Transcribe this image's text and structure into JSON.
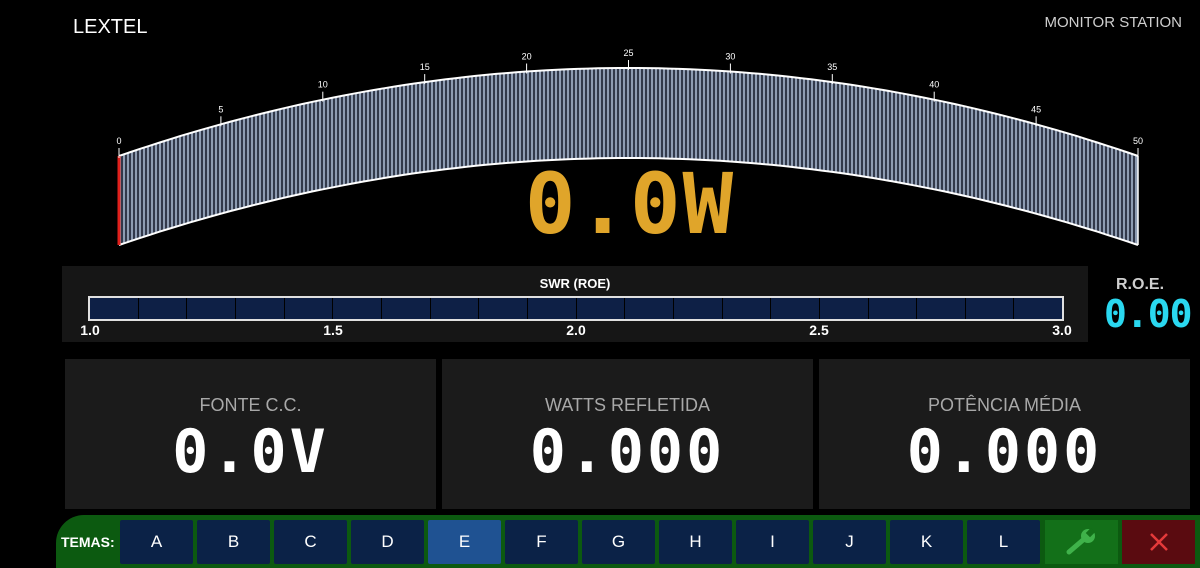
{
  "header": {
    "brand": "LEXTEL",
    "station": "MONITOR STATION"
  },
  "power_meter": {
    "scale_labels": [
      "0",
      "5",
      "10",
      "15",
      "20",
      "25",
      "30",
      "35",
      "40",
      "45",
      "50"
    ],
    "value": 0,
    "readout": "0.0W",
    "colors": {
      "needle": "#e0201c",
      "readout": "#e0a52a",
      "fill": "#8e9cb2"
    }
  },
  "swr": {
    "title": "SWR (ROE)",
    "ticks": [
      "1.0",
      "1.5",
      "2.0",
      "2.5",
      "3.0"
    ],
    "level": 0
  },
  "roe": {
    "label": "R.O.E.",
    "value": "0.00",
    "color": "#2ad8f0"
  },
  "cards": [
    {
      "label": "FONTE C.C.",
      "value": "0.0V"
    },
    {
      "label": "WATTS REFLETIDA",
      "value": "0.000"
    },
    {
      "label": "POTÊNCIA MÉDIA",
      "value": "0.000"
    }
  ],
  "themes": {
    "label": "TEMAS:",
    "buttons": [
      "A",
      "B",
      "C",
      "D",
      "E",
      "F",
      "G",
      "H",
      "I",
      "J",
      "K",
      "L"
    ],
    "active": "E"
  },
  "toolbar": {
    "settings_icon": "wrench-icon",
    "close_icon": "close-icon"
  }
}
